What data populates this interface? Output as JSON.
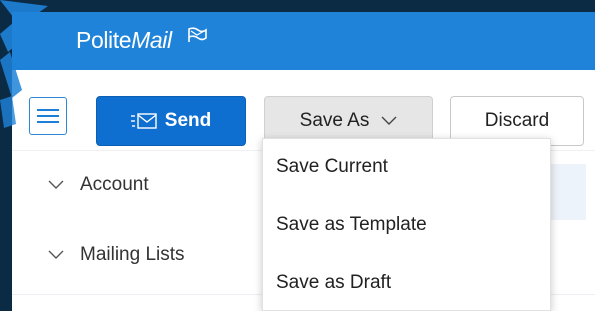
{
  "brand": {
    "name_part1": "Polite",
    "name_part2": "Mail"
  },
  "toolbar": {
    "menu_icon": "hamburger-icon",
    "send_icon": "envelope-icon",
    "send_label": "Send",
    "save_as_label": "Save As",
    "discard_label": "Discard"
  },
  "dropdown": {
    "items": [
      {
        "label": "Save Current"
      },
      {
        "label": "Save as Template"
      },
      {
        "label": "Save as Draft"
      }
    ]
  },
  "sidebar": {
    "items": [
      {
        "label": "Account"
      },
      {
        "label": "Mailing Lists"
      }
    ]
  },
  "colors": {
    "brand_bar": "#1f83d9",
    "primary_button": "#0f6fd0",
    "frame_border": "#0b2a44"
  }
}
